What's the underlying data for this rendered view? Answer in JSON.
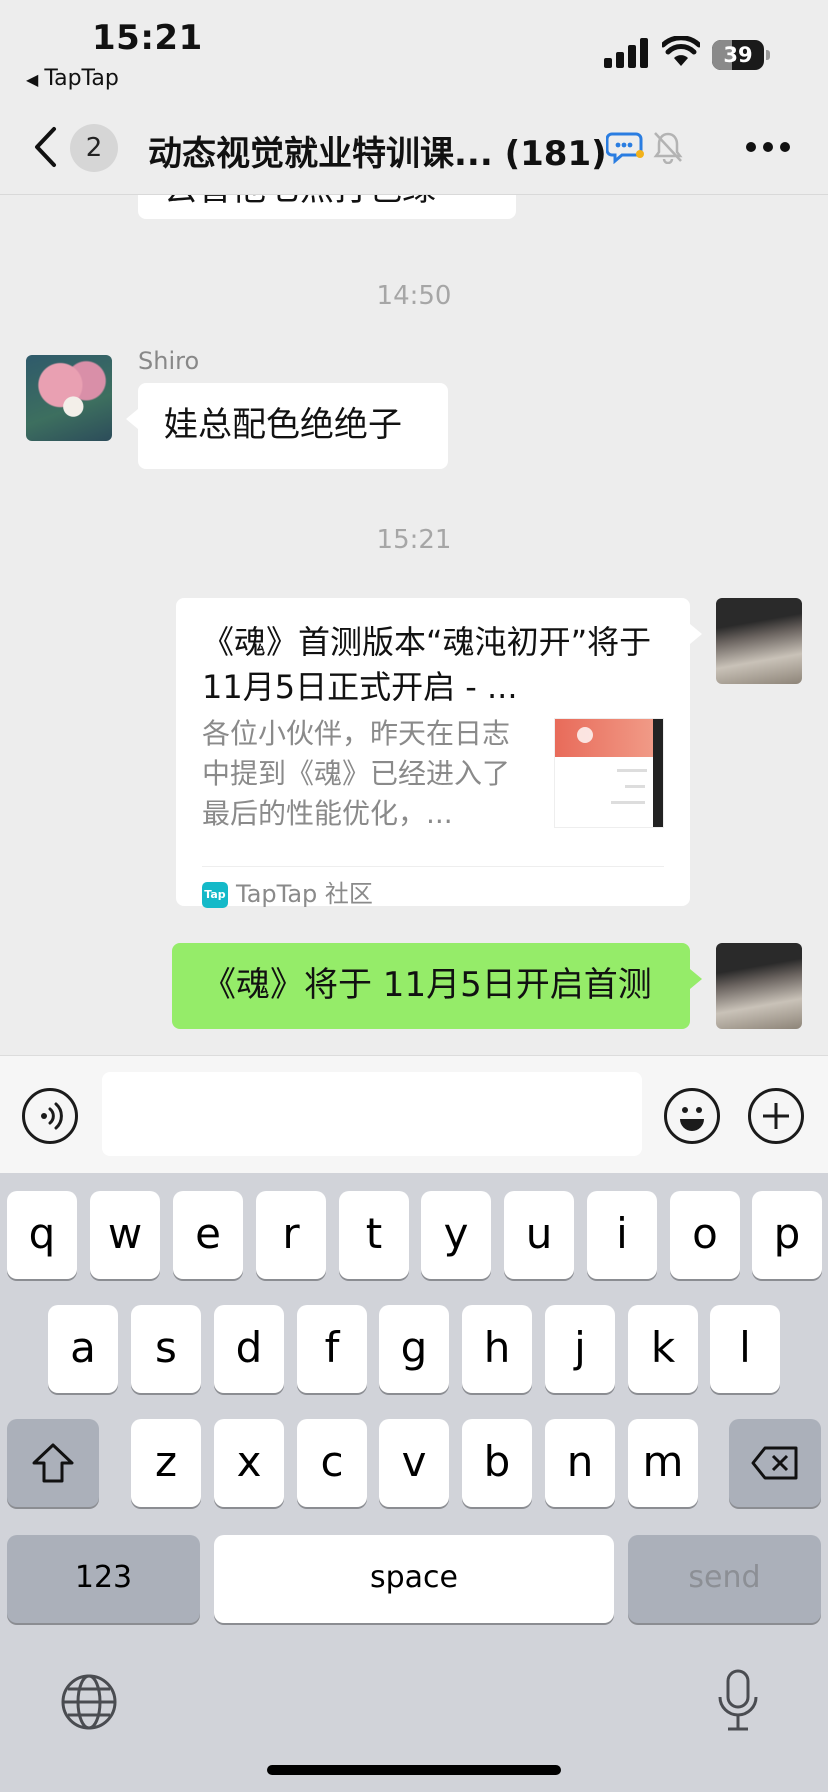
{
  "status_bar": {
    "time": "15:21",
    "back_app": "TapTap",
    "battery": "39",
    "battery_level": 0.39,
    "signal_bars": 4
  },
  "nav": {
    "unread_count": "2",
    "title": "动态视觉就业特训课... (181)"
  },
  "messages": {
    "cut_text": "去曾他七点打包绿",
    "time_1": "14:50",
    "shiro_name": "Shiro",
    "shiro_text": "娃总配色绝绝子",
    "time_2": "15:21",
    "link_card": {
      "title": "《魂》首测版本“魂沌初开”将于 11月5日正式开启 - ...",
      "desc": "各位小伙伴，昨天在日志中提到《魂》已经进入了最后的性能优化，...",
      "logo_text": "Tap",
      "source": "TapTap 社区"
    },
    "my_text": "《魂》将于 11月5日开启首测"
  },
  "input_bar": {
    "value": "",
    "placeholder": ""
  },
  "keyboard": {
    "row1": [
      "q",
      "w",
      "e",
      "r",
      "t",
      "y",
      "u",
      "i",
      "o",
      "p"
    ],
    "row2": [
      "a",
      "s",
      "d",
      "f",
      "g",
      "h",
      "j",
      "k",
      "l"
    ],
    "row3": [
      "z",
      "x",
      "c",
      "v",
      "b",
      "n",
      "m"
    ],
    "numbers_label": "123",
    "space_label": "space",
    "send_label": "send"
  },
  "icons": {
    "back": "chevron-left-icon",
    "chat": "chat-bubble-icon",
    "mute": "bell-mute-icon",
    "more": "more-icon",
    "voice": "voice-icon",
    "emoji": "emoji-icon",
    "plus": "plus-icon",
    "shift": "shift-icon",
    "delete": "delete-icon",
    "globe": "globe-icon",
    "mic": "microphone-icon"
  },
  "colors": {
    "green_bubble": "#95ec69",
    "background": "#ededed",
    "keyboard": "#d1d3d9"
  }
}
